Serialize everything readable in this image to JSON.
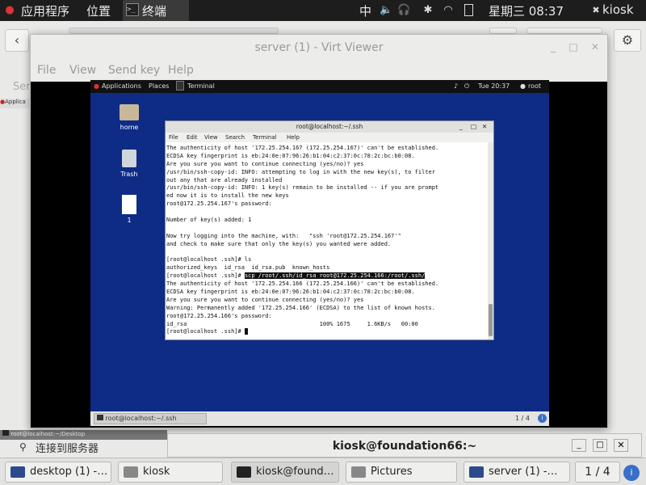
{
  "host_top": {
    "applications": "应用程序",
    "places": "位置",
    "terminal": "终端",
    "ime": "中",
    "datetime": "星期三 08:37",
    "user": "kiosk"
  },
  "host_bg": {
    "left_label": "Ser",
    "left_label2": "Applica",
    "footer_path": "root@localhost:~/Desktop",
    "connect_text": "连接到服务器"
  },
  "virt_viewer": {
    "title": "server (1) - Virt Viewer",
    "menu": [
      "File",
      "View",
      "Send key",
      "Help"
    ]
  },
  "guest": {
    "top": {
      "applications": "Applications",
      "places": "Places",
      "terminal": "Terminal",
      "time": "Tue 20:37",
      "user": "root"
    },
    "icons": [
      {
        "label": "home"
      },
      {
        "label": "Trash"
      },
      {
        "label": "1"
      }
    ],
    "taskbar": {
      "task": "root@localhost:~/.ssh",
      "pager": "1 / 4"
    },
    "terminal": {
      "title": "root@localhost:~/.ssh",
      "menu": [
        "File",
        "Edit",
        "View",
        "Search",
        "Terminal",
        "Help"
      ],
      "lines": [
        "The authenticity of host '172.25.254.167 (172.25.254.167)' can't be established.",
        "ECDSA key fingerprint is eb:24:0e:07:96:26:b1:04:c2:37:0c:78:2c:bc:b0:08.",
        "Are you sure you want to continue connecting (yes/no)? yes",
        "/usr/bin/ssh-copy-id: INFO: attempting to log in with the new key(s), to filter",
        "out any that are already installed",
        "/usr/bin/ssh-copy-id: INFO: 1 key(s) remain to be installed -- if you are prompt",
        "ed now it is to install the new keys",
        "root@172.25.254.167's password:",
        "",
        "Number of key(s) added: 1",
        "",
        "Now try logging into the machine, with:   \"ssh 'root@172.25.254.167'\"",
        "and check to make sure that only the key(s) you wanted were added.",
        "",
        "[root@localhost .ssh]# ls",
        "authorized_keys  id_rsa  id_rsa.pub  known_hosts"
      ],
      "prompt_scp": "[root@localhost .ssh]# ",
      "scp_cmd": "scp /root/.ssh/id_rsa root@172.25.254.166:/root/.ssh/",
      "lines2": [
        "The authenticity of host '172.25.254.166 (172.25.254.166)' can't be established.",
        "ECDSA key fingerprint is eb:24:0e:07:96:26:b1:04:c2:37:0c:78:2c:bc:b0:08.",
        "Are you sure you want to continue connecting (yes/no)? yes",
        "Warning: Permanently added '172.25.254.166' (ECDSA) to the list of known hosts.",
        "root@172.25.254.166's password:",
        "id_rsa                                       100% 1675     1.6KB/s   00:00"
      ],
      "prompt_last": "[root@localhost .ssh]# "
    }
  },
  "foundation_window": {
    "title": "kiosk@foundation66:~"
  },
  "taskbar": {
    "tasks": [
      "desktop (1) -…",
      "kiosk",
      "kiosk@found…",
      "Pictures",
      "server (1) -…"
    ],
    "pager": "1 / 4"
  }
}
